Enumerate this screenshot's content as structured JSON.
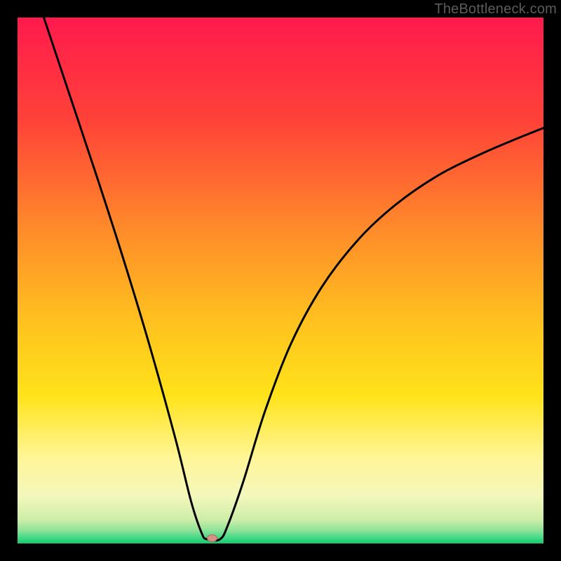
{
  "watermark": "TheBottleneck.com",
  "colors": {
    "bg_black": "#000000",
    "curve": "#000000",
    "marker_fill": "#d89189",
    "marker_stroke": "#b06a61"
  },
  "chart_data": {
    "type": "line",
    "title": "",
    "xlabel": "",
    "ylabel": "",
    "xlim": [
      0,
      100
    ],
    "ylim": [
      0,
      100
    ],
    "gradient_stops": [
      {
        "offset": 0,
        "color": "#ff1a4d"
      },
      {
        "offset": 0.2,
        "color": "#ff4338"
      },
      {
        "offset": 0.4,
        "color": "#ff8a2a"
      },
      {
        "offset": 0.58,
        "color": "#ffc21f"
      },
      {
        "offset": 0.72,
        "color": "#ffe31a"
      },
      {
        "offset": 0.84,
        "color": "#fff69a"
      },
      {
        "offset": 0.91,
        "color": "#f3f7bb"
      },
      {
        "offset": 0.955,
        "color": "#cdeea8"
      },
      {
        "offset": 0.975,
        "color": "#8fe29a"
      },
      {
        "offset": 0.99,
        "color": "#3fd885"
      },
      {
        "offset": 1.0,
        "color": "#18c76f"
      }
    ],
    "marker": {
      "x": 37,
      "y": 1
    },
    "series": [
      {
        "name": "curve",
        "points": [
          {
            "x": 5.0,
            "y": 100.0
          },
          {
            "x": 10.0,
            "y": 85.0
          },
          {
            "x": 15.0,
            "y": 70.0
          },
          {
            "x": 20.0,
            "y": 54.5
          },
          {
            "x": 25.0,
            "y": 38.0
          },
          {
            "x": 30.0,
            "y": 20.0
          },
          {
            "x": 33.0,
            "y": 8.0
          },
          {
            "x": 35.0,
            "y": 2.0
          },
          {
            "x": 36.0,
            "y": 0.8
          },
          {
            "x": 38.5,
            "y": 0.8
          },
          {
            "x": 40.0,
            "y": 3.5
          },
          {
            "x": 43.0,
            "y": 12.0
          },
          {
            "x": 47.0,
            "y": 25.0
          },
          {
            "x": 52.0,
            "y": 38.0
          },
          {
            "x": 58.0,
            "y": 49.0
          },
          {
            "x": 65.0,
            "y": 58.0
          },
          {
            "x": 72.0,
            "y": 64.5
          },
          {
            "x": 80.0,
            "y": 70.0
          },
          {
            "x": 88.0,
            "y": 74.0
          },
          {
            "x": 95.0,
            "y": 77.0
          },
          {
            "x": 100.0,
            "y": 79.0
          }
        ]
      }
    ]
  }
}
